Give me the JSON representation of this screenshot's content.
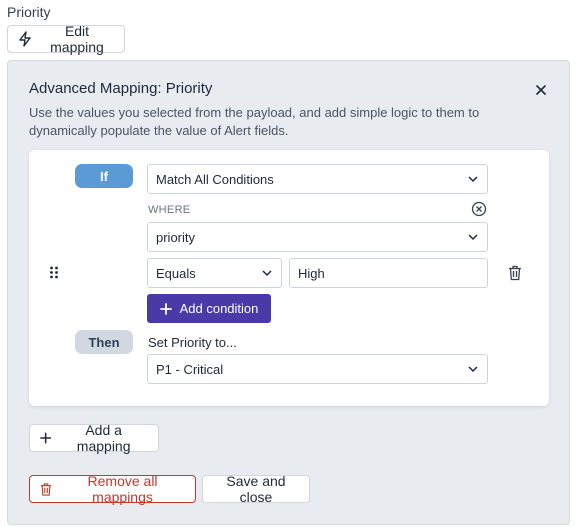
{
  "field": {
    "label": "Priority"
  },
  "edit_mapping": {
    "label": "Edit mapping",
    "icon": "lightning-icon"
  },
  "panel": {
    "title": "Advanced Mapping: Priority",
    "description": "Use the values you selected from the payload, and add simple logic to them to dynamically populate the value of Alert fields."
  },
  "rule": {
    "if_label": "If",
    "match_select": "Match All Conditions",
    "where_label": "WHERE",
    "field_select": "priority",
    "operator_select": "Equals",
    "value_input": "High",
    "add_condition_label": "Add condition",
    "then_label": "Then",
    "then_text": "Set Priority to...",
    "priority_select": "P1 - Critical"
  },
  "footer": {
    "add_mapping_label": "Add a mapping",
    "remove_all_label": "Remove all mappings",
    "save_close_label": "Save and close"
  },
  "colors": {
    "primary_button": "#4a3aa8",
    "if_pill": "#5b9bd5",
    "then_pill": "#d1d8e2",
    "danger": "#c0392b",
    "panel_bg": "#e8ecf1"
  }
}
